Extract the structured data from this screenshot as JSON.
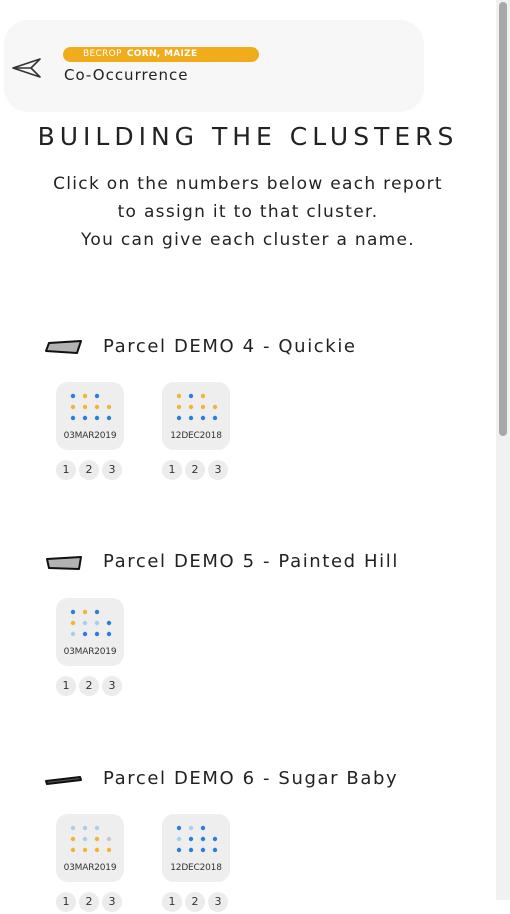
{
  "header": {
    "badge_light": "BECROP",
    "badge_bold": "CORN, MAIZE",
    "subtitle": "Co-Occurrence"
  },
  "page_title": "BUILDING THE CLUSTERS",
  "instructions": [
    "Click on the numbers below each report",
    "to assign it to that cluster.",
    "You can give each cluster a name."
  ],
  "colors": {
    "badge": "#f0ac1c",
    "dot_blue": "#2a7fdc",
    "dot_yellow": "#f2b533",
    "dot_lightblue": "#a9cdee",
    "dot_grey": "#c9c9c9"
  },
  "parcels": [
    {
      "name": "Parcel DEMO 4 - Quickie",
      "icon": "parcel-shape-icon",
      "reports": [
        {
          "date": "03MAR2019",
          "clusters": [
            "1",
            "2",
            "3"
          ]
        },
        {
          "date": "12DEC2018",
          "clusters": [
            "1",
            "2",
            "3"
          ]
        }
      ]
    },
    {
      "name": "Parcel DEMO 5 - Painted Hill",
      "icon": "parcel-shape-icon",
      "reports": [
        {
          "date": "03MAR2019",
          "clusters": [
            "1",
            "2",
            "3"
          ]
        }
      ]
    },
    {
      "name": "Parcel DEMO 6 - Sugar Baby",
      "icon": "parcel-shape-icon",
      "reports": [
        {
          "date": "03MAR2019",
          "clusters": [
            "1",
            "2",
            "3"
          ]
        },
        {
          "date": "12DEC2018",
          "clusters": [
            "1",
            "2",
            "3"
          ]
        }
      ]
    }
  ]
}
